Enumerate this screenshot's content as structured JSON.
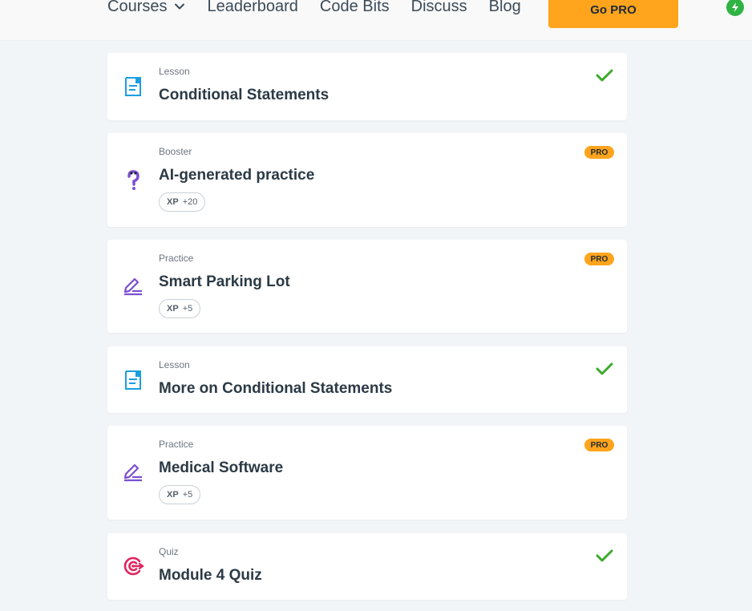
{
  "nav": {
    "courses": "Courses",
    "leaderboard": "Leaderboard",
    "code_bits": "Code Bits",
    "discuss": "Discuss",
    "blog": "Blog",
    "go_pro": "Go PRO"
  },
  "colors": {
    "accent_orange": "#ffa41c",
    "check_green": "#3caa2a",
    "lesson_blue": "#1a9ee0",
    "practice_purple": "#7b4fd0",
    "quiz_pink": "#e0245e"
  },
  "cards": [
    {
      "type": "Lesson",
      "title": "Conditional Statements",
      "icon": "lesson-icon",
      "status": "completed"
    },
    {
      "type": "Booster",
      "title": "AI-generated practice",
      "icon": "ai-practice-icon",
      "badge": "PRO",
      "xp_label": "XP",
      "xp_value": "+20"
    },
    {
      "type": "Practice",
      "title": "Smart Parking Lot",
      "icon": "practice-pencil-icon",
      "badge": "PRO",
      "xp_label": "XP",
      "xp_value": "+5"
    },
    {
      "type": "Lesson",
      "title": "More on Conditional Statements",
      "icon": "lesson-icon",
      "status": "completed"
    },
    {
      "type": "Practice",
      "title": "Medical Software",
      "icon": "practice-pencil-icon",
      "badge": "PRO",
      "xp_label": "XP",
      "xp_value": "+5"
    },
    {
      "type": "Quiz",
      "title": "Module 4 Quiz",
      "icon": "quiz-target-icon",
      "status": "completed"
    }
  ]
}
